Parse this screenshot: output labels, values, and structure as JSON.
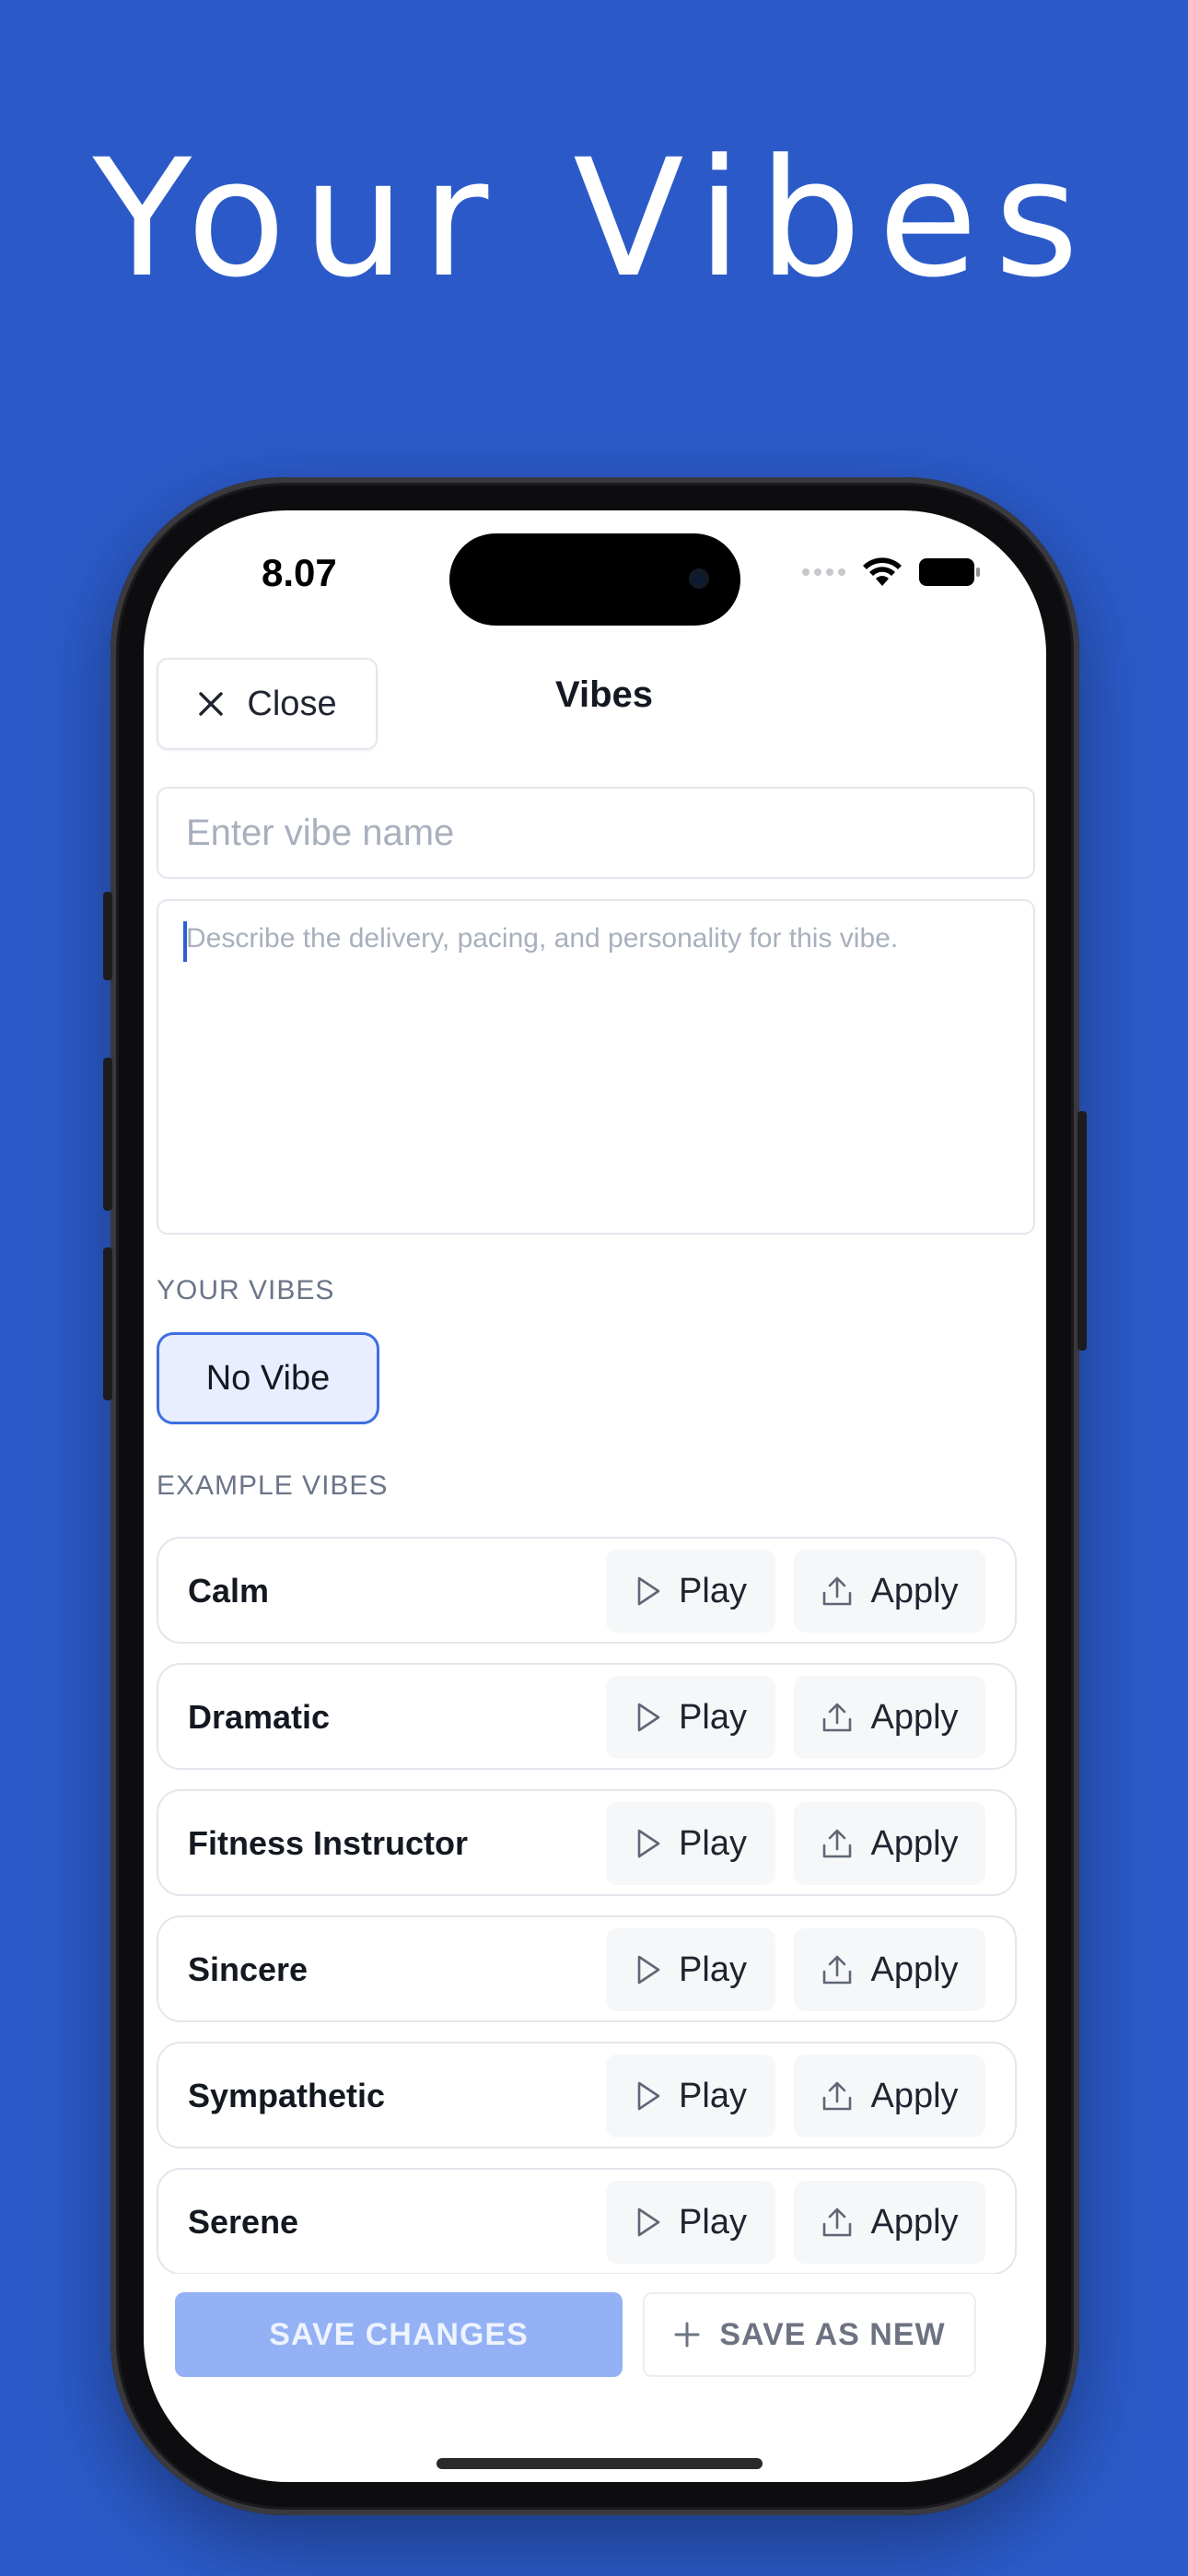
{
  "headline": "Your Vibes",
  "status_bar": {
    "time": "8.07"
  },
  "header": {
    "close_label": "Close",
    "title": "Vibes"
  },
  "form": {
    "name_placeholder": "Enter vibe name",
    "description_placeholder": "Describe the delivery, pacing, and personality for this vibe."
  },
  "your_vibes": {
    "label": "YOUR VIBES",
    "chips": [
      "No Vibe"
    ]
  },
  "example_vibes": {
    "label": "EXAMPLE VIBES",
    "play_label": "Play",
    "apply_label": "Apply",
    "items": [
      {
        "name": "Calm"
      },
      {
        "name": "Dramatic"
      },
      {
        "name": "Fitness Instructor"
      },
      {
        "name": "Sincere"
      },
      {
        "name": "Sympathetic"
      },
      {
        "name": "Serene"
      }
    ]
  },
  "footer": {
    "save_changes_label": "SAVE CHANGES",
    "save_as_new_label": "SAVE AS NEW"
  },
  "colors": {
    "background": "#2b5ac8",
    "accent": "#3e6ee0",
    "save_disabled": "#93b1f4"
  }
}
